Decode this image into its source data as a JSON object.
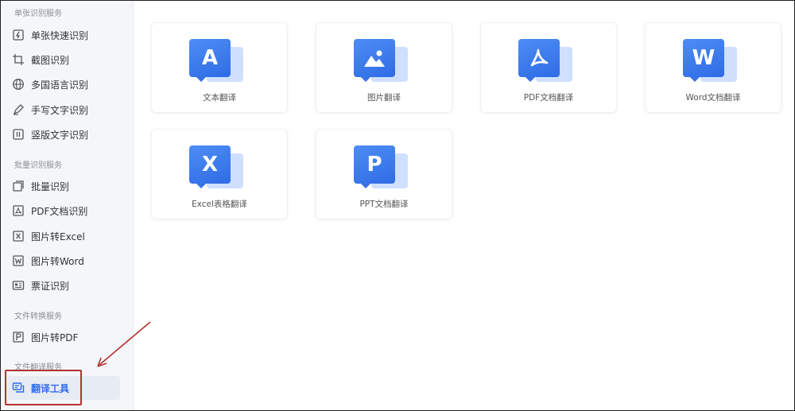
{
  "sidebar": {
    "sections": [
      {
        "title": "单张识别服务",
        "items": [
          {
            "label": "单张快速识别",
            "icon": "quick-scan-icon"
          },
          {
            "label": "截图识别",
            "icon": "crop-icon"
          },
          {
            "label": "多国语言识别",
            "icon": "globe-icon"
          },
          {
            "label": "手写文字识别",
            "icon": "pen-icon"
          },
          {
            "label": "竖版文字识别",
            "icon": "vertical-text-icon"
          }
        ]
      },
      {
        "title": "批量识别服务",
        "items": [
          {
            "label": "批量识别",
            "icon": "batch-icon"
          },
          {
            "label": "PDF文档识别",
            "icon": "pdf-doc-icon"
          },
          {
            "label": "图片转Excel",
            "icon": "excel-icon"
          },
          {
            "label": "图片转Word",
            "icon": "word-icon"
          },
          {
            "label": "票证识别",
            "icon": "ticket-icon"
          }
        ]
      },
      {
        "title": "文件转换服务",
        "items": [
          {
            "label": "图片转PDF",
            "icon": "pdf-icon"
          }
        ]
      },
      {
        "title": "文件翻译服务",
        "items": [
          {
            "label": "翻译工具",
            "icon": "translate-icon",
            "active": true
          }
        ]
      }
    ]
  },
  "cards": [
    {
      "label": "文本翻译",
      "glyph": "A",
      "icon": "text-translate-icon"
    },
    {
      "label": "图片翻译",
      "glyph": "",
      "icon": "image-translate-icon"
    },
    {
      "label": "PDF文档翻译",
      "glyph": "",
      "icon": "pdf-translate-icon"
    },
    {
      "label": "Word文档翻译",
      "glyph": "W",
      "icon": "word-translate-icon"
    },
    {
      "label": "Excel表格翻译",
      "glyph": "X",
      "icon": "excel-translate-icon"
    },
    {
      "label": "PPT文档翻译",
      "glyph": "P",
      "icon": "ppt-translate-icon"
    }
  ],
  "colors": {
    "accent": "#2f6df0",
    "tile_blue": "#3a78ec",
    "tile_back": "#cfe0ff",
    "annotation_red": "#b3322e",
    "sidebar_bg": "#f4f6f9"
  }
}
